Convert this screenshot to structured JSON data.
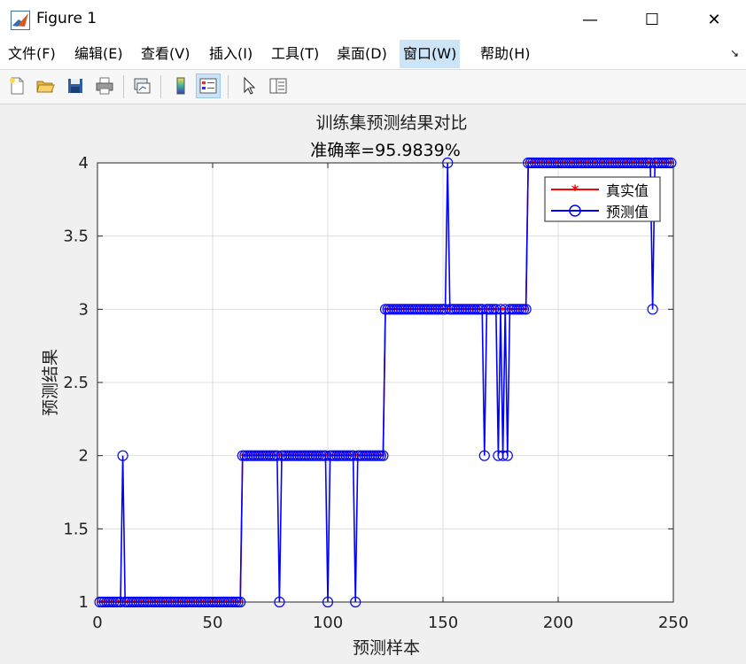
{
  "window": {
    "title": "Figure 1",
    "minimize_glyph": "—",
    "maximize_glyph": "☐",
    "close_glyph": "✕"
  },
  "menu": {
    "items": [
      {
        "label": "文件(F)"
      },
      {
        "label": "编辑(E)"
      },
      {
        "label": "查看(V)"
      },
      {
        "label": "插入(I)"
      },
      {
        "label": "工具(T)"
      },
      {
        "label": "桌面(D)"
      },
      {
        "label": "窗口(W)"
      },
      {
        "label": "帮助(H)"
      }
    ],
    "active_index": 6,
    "corner_glyph": "↘"
  },
  "toolbar": {
    "icons": [
      "new-figure-icon",
      "open-file-icon",
      "save-icon",
      "print-icon",
      "link-plot-icon",
      "colorbar-icon",
      "legend-icon",
      "pointer-icon",
      "property-editor-icon"
    ]
  },
  "chart_data": {
    "type": "line",
    "title": "训练集预测结果对比",
    "subtitle": "准确率=95.9839%",
    "xlabel": "预测样本",
    "ylabel": "预测结果",
    "xlim": [
      0,
      250
    ],
    "ylim": [
      1,
      4
    ],
    "xticks": [
      0,
      50,
      100,
      150,
      200,
      250
    ],
    "yticks": [
      1,
      1.5,
      2,
      2.5,
      3,
      3.5,
      4
    ],
    "grid": true,
    "legend_position": "top-right",
    "n_samples": 249,
    "segments": [
      {
        "from": 1,
        "to": 62,
        "value": 1
      },
      {
        "from": 63,
        "to": 124,
        "value": 2
      },
      {
        "from": 125,
        "to": 186,
        "value": 3
      },
      {
        "from": 187,
        "to": 249,
        "value": 4
      }
    ],
    "prediction_errors": [
      {
        "x": 11,
        "value": 2
      },
      {
        "x": 79,
        "value": 1
      },
      {
        "x": 100,
        "value": 1
      },
      {
        "x": 112,
        "value": 1
      },
      {
        "x": 152,
        "value": 4
      },
      {
        "x": 168,
        "value": 2
      },
      {
        "x": 174,
        "value": 2
      },
      {
        "x": 176,
        "value": 2
      },
      {
        "x": 178,
        "value": 2
      },
      {
        "x": 241,
        "value": 3
      }
    ],
    "series": [
      {
        "name": "真实值",
        "color": "#ff0000",
        "marker": "*"
      },
      {
        "name": "预测值",
        "color": "#0000ff",
        "marker": "o"
      }
    ]
  }
}
